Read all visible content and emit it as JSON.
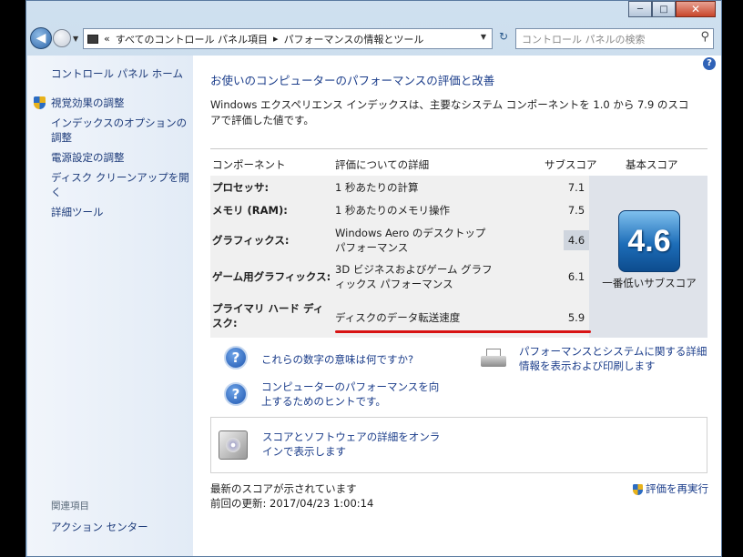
{
  "window": {
    "caption": {
      "minimize": "─",
      "maximize": "□",
      "close": "✕"
    }
  },
  "address": {
    "back_glyph": "◀",
    "recent_glyph": "▼",
    "separator": "«",
    "crumb1": "すべてのコントロール パネル項目",
    "arrow": "▸",
    "crumb2": "パフォーマンスの情報とツール",
    "dropdown": "▼",
    "refresh": "↻",
    "search_placeholder": "コントロール パネルの検索",
    "search_glyph": "⚲"
  },
  "sidebar": {
    "home": "コントロール パネル ホーム",
    "items": [
      {
        "label": "視覚効果の調整",
        "icon": "shield-icon"
      },
      {
        "label": "インデックスのオプションの調整",
        "icon": ""
      },
      {
        "label": "電源設定の調整",
        "icon": ""
      },
      {
        "label": "ディスク クリーンアップを開く",
        "icon": ""
      },
      {
        "label": "詳細ツール",
        "icon": ""
      }
    ],
    "related_heading": "関連項目",
    "action_center": "アクション センター"
  },
  "main": {
    "help": "?",
    "heading": "お使いのコンピューターのパフォーマンスの評価と改善",
    "description": "Windows エクスペリエンス インデックスは、主要なシステム コンポーネントを 1.0 から 7.9 のスコアで評価した値です。",
    "table": {
      "headers": {
        "component": "コンポーネント",
        "details": "評価についての詳細",
        "subscore": "サブスコア",
        "basescore": "基本スコア"
      },
      "rows": [
        {
          "name": "プロセッサ:",
          "desc": "1 秒あたりの計算",
          "score": "7.1"
        },
        {
          "name": "メモリ (RAM):",
          "desc": "1 秒あたりのメモリ操作",
          "score": "7.5"
        },
        {
          "name": "グラフィックス:",
          "desc": "Windows Aero のデスクトップ パフォーマンス",
          "score": "4.6"
        },
        {
          "name": "ゲーム用グラフィックス:",
          "desc": "3D ビジネスおよびゲーム グラフィックス パフォーマンス",
          "score": "6.1"
        },
        {
          "name": "プライマリ ハード ディスク:",
          "desc": "ディスクのデータ転送速度",
          "score": "5.9"
        }
      ],
      "base_score": "4.6",
      "base_caption": "一番低いサブスコア"
    },
    "links": {
      "meaning": "これらの数字の意味は何ですか?",
      "tips": "コンピューターのパフォーマンスを向上するためのヒントです。",
      "print": "パフォーマンスとシステムに関する詳細情報を表示および印刷します",
      "online": "スコアとソフトウェアの詳細をオンラインで表示します"
    },
    "status": {
      "latest": "最新のスコアが示されています",
      "last_update": "前回の更新: 2017/04/23 1:00:14",
      "rerun": "評価を再実行"
    }
  },
  "colors": {
    "link": "#1a3c8a",
    "highlight_line": "#d81414",
    "score_badge": "#1d6db8"
  }
}
